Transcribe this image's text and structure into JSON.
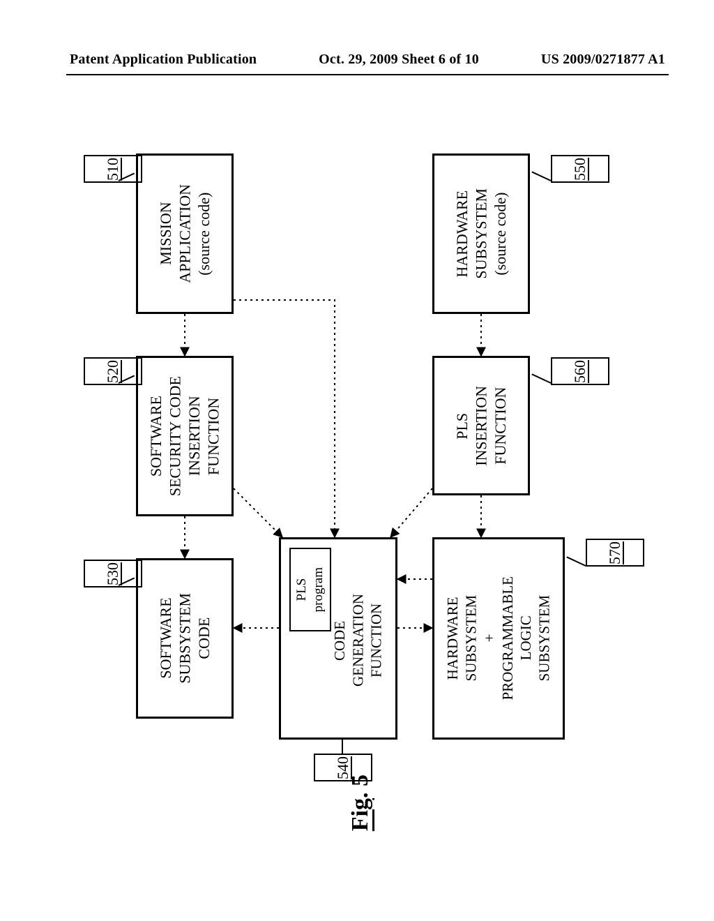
{
  "header": {
    "left": "Patent Application Publication",
    "center": "Oct. 29, 2009  Sheet 6 of 10",
    "right": "US 2009/0271877 A1"
  },
  "figure_label": {
    "prefix": "Fig",
    "num": ". 5"
  },
  "refs": {
    "r510": "510",
    "r520": "520",
    "r530": "530",
    "r540": "540",
    "r550": "550",
    "r560": "560",
    "r570": "570"
  },
  "boxes": {
    "b510": "MISSION\nAPPLICATION\n(source code)",
    "b520": "SOFTWARE\nSECURITY CODE\nINSERTION\nFUNCTION",
    "b530": "SOFTWARE\nSUBSYSTEM\nCODE",
    "b540_outer": "CODE\nGENERATION\nFUNCTION",
    "b540_inner": "PLS\nprogram",
    "b550": "HARDWARE\nSUBSYSTEM\n(source code)",
    "b560": "PLS\nINSERTION\nFUNCTION",
    "b570": "HARDWARE\nSUBSYSTEM\n+\nPROGRAMMABLE\nLOGIC\nSUBSYSTEM"
  }
}
